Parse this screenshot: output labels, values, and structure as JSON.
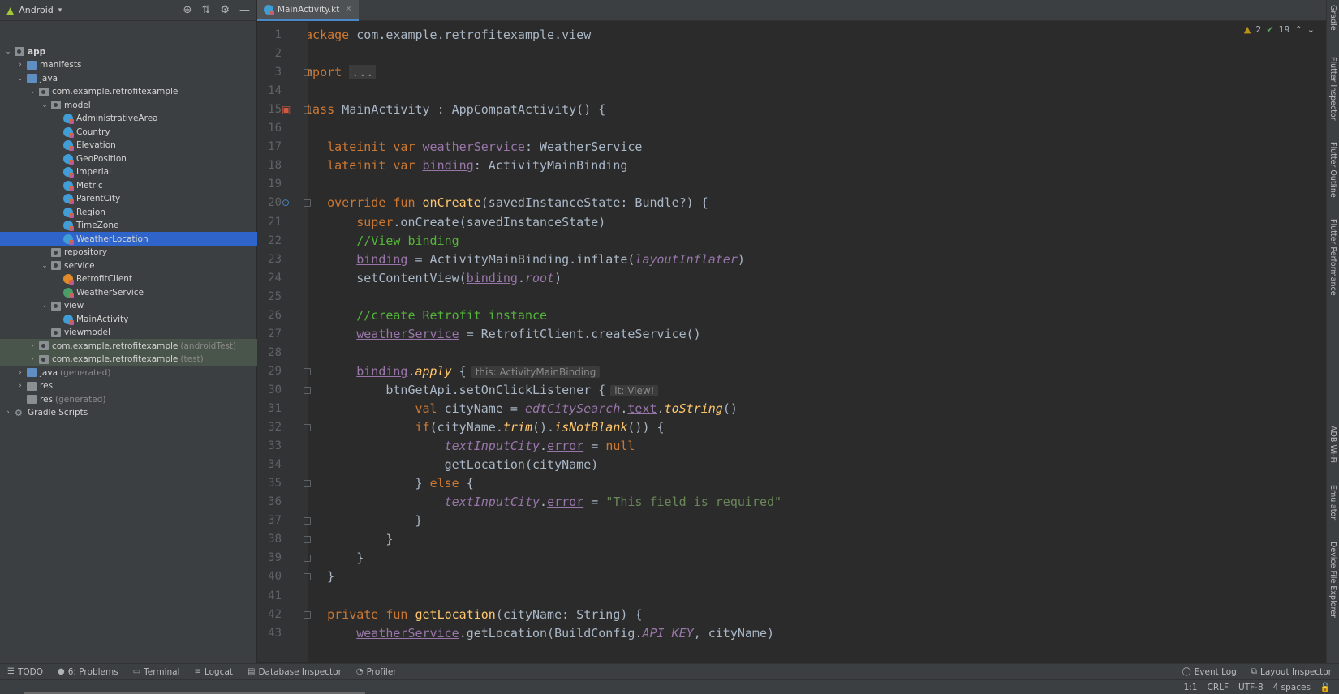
{
  "project": {
    "view_label": "Android",
    "tree": [
      {
        "depth": 0,
        "arrow": "v",
        "icon": "folder-pkg",
        "label": "app",
        "bold": true
      },
      {
        "depth": 1,
        "arrow": ">",
        "icon": "folder-blue",
        "label": "manifests"
      },
      {
        "depth": 1,
        "arrow": "v",
        "icon": "folder-blue",
        "label": "java"
      },
      {
        "depth": 2,
        "arrow": "v",
        "icon": "folder-pkg",
        "label": "com.example.retrofitexample"
      },
      {
        "depth": 3,
        "arrow": "v",
        "icon": "folder-pkg",
        "label": "model"
      },
      {
        "depth": 4,
        "arrow": "",
        "icon": "kt",
        "label": "AdministrativeArea"
      },
      {
        "depth": 4,
        "arrow": "",
        "icon": "kt",
        "label": "Country"
      },
      {
        "depth": 4,
        "arrow": "",
        "icon": "kt",
        "label": "Elevation"
      },
      {
        "depth": 4,
        "arrow": "",
        "icon": "kt",
        "label": "GeoPosition"
      },
      {
        "depth": 4,
        "arrow": "",
        "icon": "kt",
        "label": "Imperial"
      },
      {
        "depth": 4,
        "arrow": "",
        "icon": "kt",
        "label": "Metric"
      },
      {
        "depth": 4,
        "arrow": "",
        "icon": "kt",
        "label": "ParentCity"
      },
      {
        "depth": 4,
        "arrow": "",
        "icon": "kt",
        "label": "Region"
      },
      {
        "depth": 4,
        "arrow": "",
        "icon": "kt",
        "label": "TimeZone"
      },
      {
        "depth": 4,
        "arrow": "",
        "icon": "kt",
        "label": "WeatherLocation",
        "selected": true
      },
      {
        "depth": 3,
        "arrow": "",
        "icon": "folder-pkg",
        "label": "repository"
      },
      {
        "depth": 3,
        "arrow": "v",
        "icon": "folder-pkg",
        "label": "service"
      },
      {
        "depth": 4,
        "arrow": "",
        "icon": "kt-orange",
        "label": "RetrofitClient"
      },
      {
        "depth": 4,
        "arrow": "",
        "icon": "kt-green",
        "label": "WeatherService"
      },
      {
        "depth": 3,
        "arrow": "v",
        "icon": "folder-pkg",
        "label": "view"
      },
      {
        "depth": 4,
        "arrow": "",
        "icon": "kt",
        "label": "MainActivity"
      },
      {
        "depth": 3,
        "arrow": "",
        "icon": "folder-pkg",
        "label": "viewmodel"
      },
      {
        "depth": 2,
        "arrow": ">",
        "icon": "folder-pkg",
        "label": "com.example.retrofitexample",
        "hint": "(androidTest)",
        "test": true
      },
      {
        "depth": 2,
        "arrow": ">",
        "icon": "folder-pkg",
        "label": "com.example.retrofitexample",
        "hint": "(test)",
        "test": true
      },
      {
        "depth": 1,
        "arrow": ">",
        "icon": "folder-blue",
        "label": "java",
        "hint": "(generated)"
      },
      {
        "depth": 1,
        "arrow": ">",
        "icon": "folder",
        "label": "res"
      },
      {
        "depth": 1,
        "arrow": "",
        "icon": "folder",
        "label": "res",
        "hint": "(generated)"
      },
      {
        "depth": 0,
        "arrow": ">",
        "icon": "gradle",
        "label": "Gradle Scripts"
      }
    ]
  },
  "editor": {
    "tab_label": "MainActivity.kt",
    "inspection": {
      "warnings": "2",
      "checks": "19"
    },
    "lines": [
      {
        "n": "1",
        "tokens": [
          [
            "kw",
            "package "
          ],
          [
            "id",
            "com.example.retrofitexample.view"
          ]
        ]
      },
      {
        "n": "2",
        "tokens": []
      },
      {
        "n": "3",
        "tokens": [
          [
            "kw",
            "import "
          ],
          [
            "fold",
            "..."
          ]
        ],
        "mark": true
      },
      {
        "n": "14",
        "tokens": []
      },
      {
        "n": "15",
        "tokens": [
          [
            "kw",
            "class "
          ],
          [
            "id",
            "MainActivity : AppCompatActivity() {"
          ]
        ],
        "mark": true,
        "gicon": "class"
      },
      {
        "n": "16",
        "tokens": []
      },
      {
        "n": "17",
        "tokens": [
          [
            "id",
            "    "
          ],
          [
            "kw",
            "lateinit var "
          ],
          [
            "prop",
            "weatherService"
          ],
          [
            "id",
            ": WeatherService"
          ]
        ]
      },
      {
        "n": "18",
        "tokens": [
          [
            "id",
            "    "
          ],
          [
            "kw",
            "lateinit var "
          ],
          [
            "prop",
            "binding"
          ],
          [
            "id",
            ": ActivityMainBinding"
          ]
        ]
      },
      {
        "n": "19",
        "tokens": []
      },
      {
        "n": "20",
        "tokens": [
          [
            "id",
            "    "
          ],
          [
            "kw",
            "override fun "
          ],
          [
            "fn",
            "onCreate"
          ],
          [
            "id",
            "(savedInstanceState: Bundle?) {"
          ]
        ],
        "mark": true,
        "gicon": "override"
      },
      {
        "n": "21",
        "tokens": [
          [
            "id",
            "        "
          ],
          [
            "kw",
            "super"
          ],
          [
            "id",
            ".onCreate(savedInstanceState)"
          ]
        ]
      },
      {
        "n": "22",
        "tokens": [
          [
            "id",
            "        "
          ],
          [
            "cm",
            "//View binding"
          ]
        ]
      },
      {
        "n": "23",
        "tokens": [
          [
            "id",
            "        "
          ],
          [
            "prop",
            "binding"
          ],
          [
            "id",
            " = ActivityMainBinding.inflate("
          ],
          [
            "ital",
            "layoutInflater"
          ],
          [
            "id",
            ")"
          ]
        ]
      },
      {
        "n": "24",
        "tokens": [
          [
            "id",
            "        setContentView("
          ],
          [
            "prop",
            "binding"
          ],
          [
            "id",
            "."
          ],
          [
            "ital",
            "root"
          ],
          [
            "id",
            ")"
          ]
        ]
      },
      {
        "n": "25",
        "tokens": []
      },
      {
        "n": "26",
        "tokens": [
          [
            "id",
            "        "
          ],
          [
            "cm",
            "//create Retrofit instance"
          ]
        ]
      },
      {
        "n": "27",
        "tokens": [
          [
            "id",
            "        "
          ],
          [
            "prop",
            "weatherService"
          ],
          [
            "id",
            " = RetrofitClient.createService()"
          ]
        ]
      },
      {
        "n": "28",
        "tokens": []
      },
      {
        "n": "29",
        "tokens": [
          [
            "id",
            "        "
          ],
          [
            "prop",
            "binding"
          ],
          [
            "id",
            "."
          ],
          [
            "italfn",
            "apply"
          ],
          [
            "id",
            " {"
          ],
          [
            "hint",
            "this: ActivityMainBinding"
          ]
        ],
        "mark": true
      },
      {
        "n": "30",
        "tokens": [
          [
            "id",
            "            btnGetApi.setOnClickListener {"
          ],
          [
            "hint",
            "it: View!"
          ]
        ],
        "mark": true
      },
      {
        "n": "31",
        "tokens": [
          [
            "id",
            "                "
          ],
          [
            "kw",
            "val "
          ],
          [
            "id",
            "cityName = "
          ],
          [
            "ital",
            "edtCitySearch"
          ],
          [
            "id",
            "."
          ],
          [
            "prop",
            "text"
          ],
          [
            "id",
            "."
          ],
          [
            "italfn",
            "toString"
          ],
          [
            "id",
            "()"
          ]
        ]
      },
      {
        "n": "32",
        "tokens": [
          [
            "id",
            "                "
          ],
          [
            "kw",
            "if"
          ],
          [
            "id",
            "(cityName."
          ],
          [
            "italfn",
            "trim"
          ],
          [
            "id",
            "()."
          ],
          [
            "italfn",
            "isNotBlank"
          ],
          [
            "id",
            "()) {"
          ]
        ],
        "mark": true
      },
      {
        "n": "33",
        "tokens": [
          [
            "id",
            "                    "
          ],
          [
            "ital",
            "textInputCity"
          ],
          [
            "id",
            "."
          ],
          [
            "prop",
            "error"
          ],
          [
            "id",
            " = "
          ],
          [
            "kw",
            "null"
          ]
        ]
      },
      {
        "n": "34",
        "tokens": [
          [
            "id",
            "                    getLocation(cityName)"
          ]
        ]
      },
      {
        "n": "35",
        "tokens": [
          [
            "id",
            "                } "
          ],
          [
            "kw",
            "else"
          ],
          [
            "id",
            " {"
          ]
        ],
        "mark": true
      },
      {
        "n": "36",
        "tokens": [
          [
            "id",
            "                    "
          ],
          [
            "ital",
            "textInputCity"
          ],
          [
            "id",
            "."
          ],
          [
            "prop",
            "error"
          ],
          [
            "id",
            " = "
          ],
          [
            "str",
            "\"This field is required\""
          ]
        ]
      },
      {
        "n": "37",
        "tokens": [
          [
            "id",
            "                }"
          ]
        ],
        "mark": true
      },
      {
        "n": "38",
        "tokens": [
          [
            "id",
            "            }"
          ]
        ],
        "mark": true
      },
      {
        "n": "39",
        "tokens": [
          [
            "id",
            "        }"
          ]
        ],
        "mark": true
      },
      {
        "n": "40",
        "tokens": [
          [
            "id",
            "    }"
          ]
        ],
        "mark": true
      },
      {
        "n": "41",
        "tokens": []
      },
      {
        "n": "42",
        "tokens": [
          [
            "id",
            "    "
          ],
          [
            "kw",
            "private fun "
          ],
          [
            "fn",
            "getLocation"
          ],
          [
            "id",
            "(cityName: String) {"
          ]
        ],
        "mark": true
      },
      {
        "n": "43",
        "tokens": [
          [
            "id",
            "        "
          ],
          [
            "prop",
            "weatherService"
          ],
          [
            "id",
            ".getLocation(BuildConfig."
          ],
          [
            "ital",
            "API_KEY"
          ],
          [
            "id",
            ", cityName)"
          ]
        ]
      }
    ]
  },
  "right_tools": [
    "Gradle",
    "Flutter Inspector",
    "Flutter Outline",
    "Flutter Performance",
    "ADB Wi-Fi",
    "Emulator",
    "Device File Explorer"
  ],
  "bottom_tools": [
    "TODO",
    "6: Problems",
    "Terminal",
    "Logcat",
    "Database Inspector",
    "Profiler"
  ],
  "bottom_tools_right": [
    "Event Log",
    "Layout Inspector"
  ],
  "status": {
    "position": "1:1",
    "line_sep": "CRLF",
    "encoding": "UTF-8",
    "indent": "4 spaces"
  }
}
